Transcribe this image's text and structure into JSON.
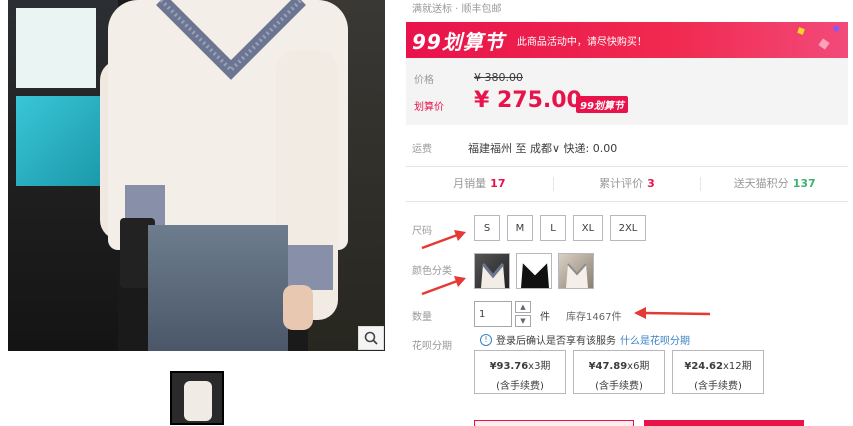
{
  "breadcrumb": "满就送标 · 顺丰包邮",
  "promo": {
    "logo": "99划算节",
    "text": "此商品活动中，请尽快购买！"
  },
  "price": {
    "label": "价格",
    "original": "¥ 380.00",
    "promo_label": "划算价",
    "current": "¥ 275.00",
    "tag": "99划算节"
  },
  "shipping": {
    "label": "运费",
    "value": "福建福州 至 成都∨ 快递: 0.00"
  },
  "stats": {
    "monthly_sales_label": "月销量",
    "monthly_sales": "17",
    "reviews_label": "累计评价",
    "reviews": "3",
    "points_label": "送天猫积分",
    "points": "137"
  },
  "size": {
    "label": "尺码",
    "options": [
      "S",
      "M",
      "L",
      "XL",
      "2XL"
    ]
  },
  "color": {
    "label": "颜色分类"
  },
  "quantity": {
    "label": "数量",
    "value": "1",
    "unit": "件",
    "stock": "库存1467件"
  },
  "huabei": {
    "label": "花呗分期",
    "notice": "登录后确认是否享有该服务",
    "link": "什么是花呗分期",
    "plans": [
      {
        "amount": "¥93.76",
        "period": "x3期",
        "fee": "(含手续费)"
      },
      {
        "amount": "¥47.89",
        "period": "x6期",
        "fee": "(含手续费)"
      },
      {
        "amount": "¥24.62",
        "period": "x12期",
        "fee": "(含手续费)"
      }
    ]
  },
  "colors": {
    "accent": "#e8134b",
    "arrow": "#e53935",
    "link": "#3b82c4",
    "green": "#3cb371"
  }
}
